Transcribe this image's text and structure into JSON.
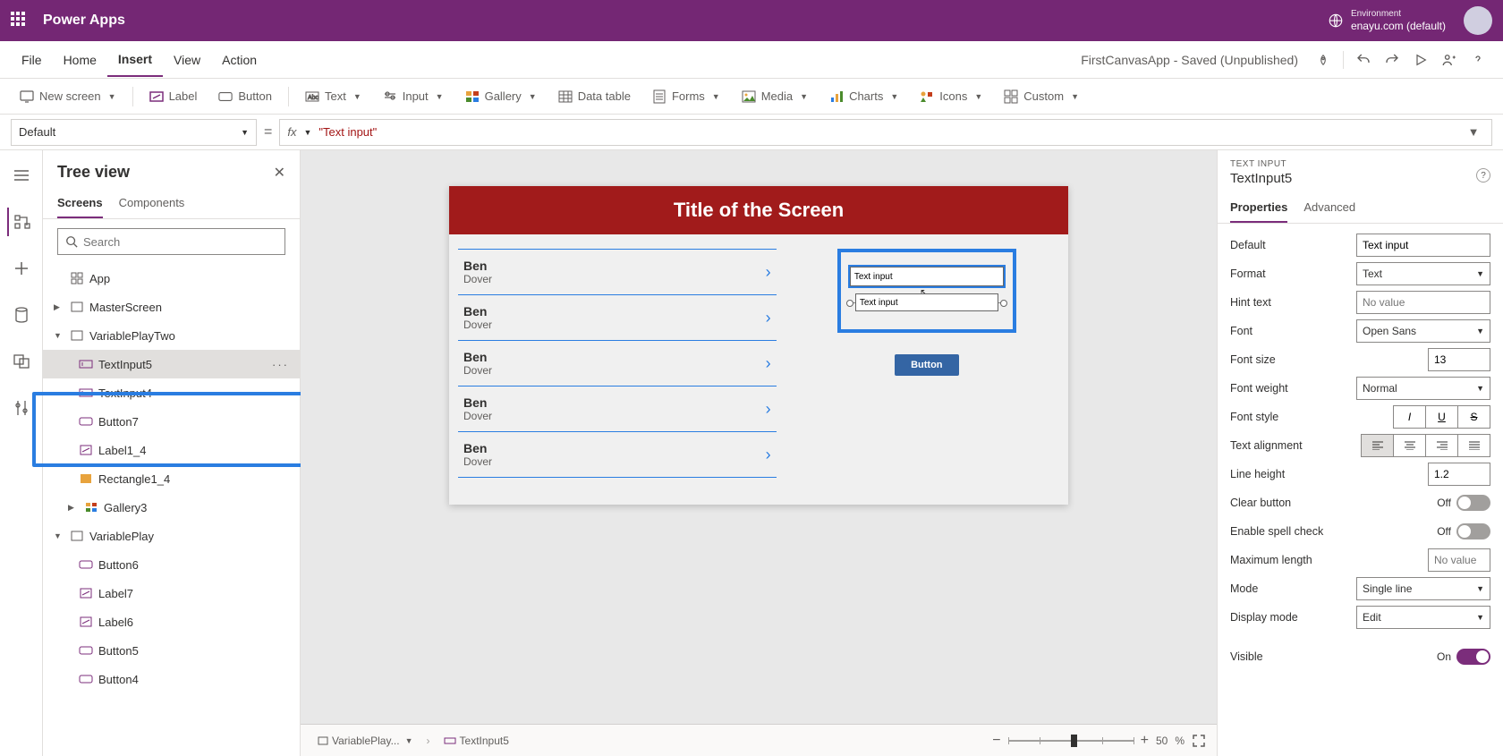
{
  "header": {
    "app_title": "Power Apps",
    "env_label": "Environment",
    "env_name": "enayu.com (default)"
  },
  "menubar": {
    "items": [
      "File",
      "Home",
      "Insert",
      "View",
      "Action"
    ],
    "active": "Insert",
    "doc_title": "FirstCanvasApp - Saved (Unpublished)"
  },
  "ribbon": {
    "new_screen": "New screen",
    "label": "Label",
    "button": "Button",
    "text": "Text",
    "input": "Input",
    "gallery": "Gallery",
    "data_table": "Data table",
    "forms": "Forms",
    "media": "Media",
    "charts": "Charts",
    "icons": "Icons",
    "custom": "Custom"
  },
  "formula": {
    "property": "Default",
    "fx": "fx",
    "value": "\"Text input\""
  },
  "tree": {
    "title": "Tree view",
    "tabs": [
      "Screens",
      "Components"
    ],
    "active_tab": "Screens",
    "search_placeholder": "Search",
    "items": {
      "app": "App",
      "master": "MasterScreen",
      "varplaytwo": "VariablePlayTwo",
      "ti5": "TextInput5",
      "ti4": "TextInput4",
      "btn7": "Button7",
      "lbl14": "Label1_4",
      "rect14": "Rectangle1_4",
      "gal3": "Gallery3",
      "varplay": "VariablePlay",
      "btn6": "Button6",
      "lbl7": "Label7",
      "lbl6": "Label6",
      "btn5": "Button5",
      "btn4": "Button4"
    }
  },
  "canvas": {
    "screen_title": "Title of the Screen",
    "gallery": [
      {
        "title": "Ben",
        "sub": "Dover"
      },
      {
        "title": "Ben",
        "sub": "Dover"
      },
      {
        "title": "Ben",
        "sub": "Dover"
      },
      {
        "title": "Ben",
        "sub": "Dover"
      },
      {
        "title": "Ben",
        "sub": "Dover"
      }
    ],
    "textinput1": "Text input",
    "textinput2": "Text input",
    "button_label": "Button",
    "breadcrumb1": "VariablePlay...",
    "breadcrumb2": "TextInput5",
    "zoom_minus": "−",
    "zoom_plus": "+",
    "zoom_value": "50",
    "zoom_pct": "%"
  },
  "props": {
    "ctrl_type": "TEXT INPUT",
    "ctrl_name": "TextInput5",
    "tabs": [
      "Properties",
      "Advanced"
    ],
    "active_tab": "Properties",
    "rows": {
      "default": "Default",
      "default_v": "Text input",
      "format": "Format",
      "format_v": "Text",
      "hint": "Hint text",
      "hint_v": "No value",
      "font": "Font",
      "font_v": "Open Sans",
      "fsize": "Font size",
      "fsize_v": "13",
      "fweight": "Font weight",
      "fweight_v": "Normal",
      "fstyle": "Font style",
      "talign": "Text alignment",
      "lheight": "Line height",
      "lheight_v": "1.2",
      "clear": "Clear button",
      "clear_v": "Off",
      "spell": "Enable spell check",
      "spell_v": "Off",
      "maxlen": "Maximum length",
      "maxlen_v": "No value",
      "mode": "Mode",
      "mode_v": "Single line",
      "dmode": "Display mode",
      "dmode_v": "Edit",
      "visible": "Visible",
      "visible_v": "On"
    }
  }
}
